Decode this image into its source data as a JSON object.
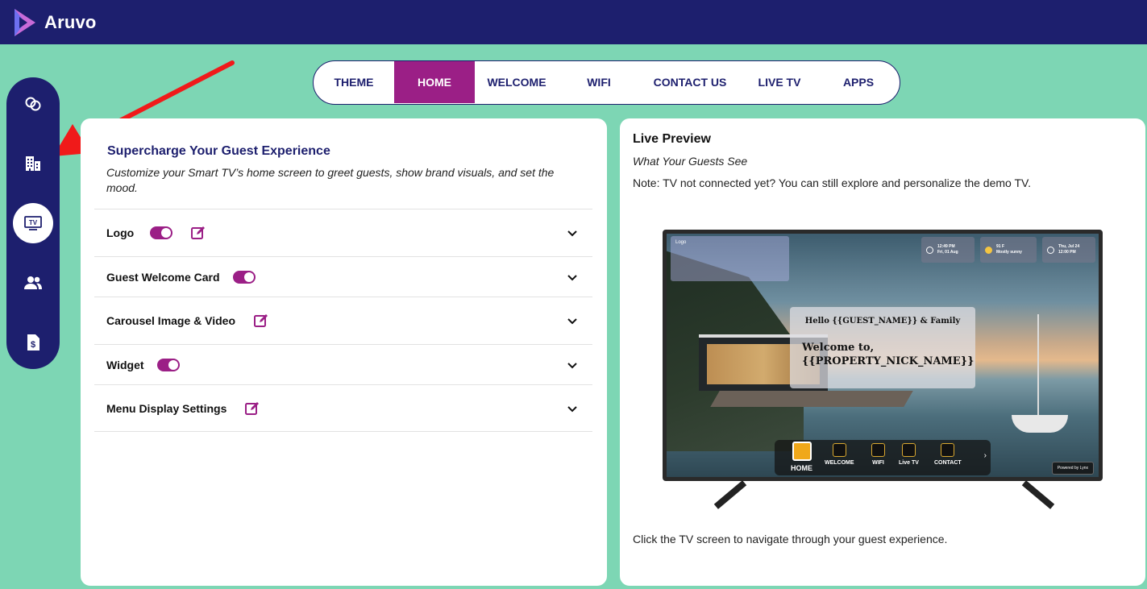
{
  "app": {
    "name": "Aruvo"
  },
  "sidebar": {
    "items": [
      {
        "icon": "linked-rings-icon"
      },
      {
        "icon": "building-icon"
      },
      {
        "icon": "tv-icon",
        "label": "TV",
        "active": true
      },
      {
        "icon": "users-icon"
      },
      {
        "icon": "invoice-icon"
      }
    ]
  },
  "tabs": [
    {
      "label": "THEME"
    },
    {
      "label": "HOME",
      "active": true
    },
    {
      "label": "WELCOME"
    },
    {
      "label": "WIFI"
    },
    {
      "label": "CONTACT US"
    },
    {
      "label": "LIVE TV"
    },
    {
      "label": "APPS"
    }
  ],
  "settings": {
    "title": "Supercharge Your Guest Experience",
    "description": "Customize your Smart TV’s home screen to greet guests, show brand visuals, and set the mood.",
    "sections": [
      {
        "label": "Logo",
        "toggle": true,
        "edit": true
      },
      {
        "label": "Guest Welcome Card",
        "toggle": true,
        "edit": false
      },
      {
        "label": "Carousel Image & Video",
        "toggle": false,
        "edit": true
      },
      {
        "label": "Widget",
        "toggle": true,
        "edit": false
      },
      {
        "label": "Menu Display Settings",
        "toggle": false,
        "edit": true
      }
    ]
  },
  "preview": {
    "title": "Live Preview",
    "subtitle": "What Your Guests See",
    "note": "Note: TV not connected yet? You can still explore and personalize the demo TV.",
    "footer": "Click the TV screen to navigate through your guest experience.",
    "tv": {
      "logo_alt": "Logo",
      "widgets": {
        "time": "12:49 PM",
        "date": "Fri, 01 Aug",
        "temp": "91 F",
        "weather": "Mostly sunny",
        "checkout_date": "Thu, Jul 24",
        "checkout_time": "12:00 PM"
      },
      "hello": "Hello {{GUEST_NAME}} & Family",
      "welcome_line1": "Welcome to,",
      "welcome_line2": "{{PROPERTY_NICK_NAME}}",
      "menu": [
        "HOME",
        "WELCOME",
        "WIFI",
        "Live TV",
        "CONTACT"
      ],
      "menu_more": "›",
      "powered_by": "Powered by Lynx"
    }
  },
  "colors": {
    "navy": "#1d1f6e",
    "magenta": "#9b1f86",
    "mint": "#7dd6b4"
  }
}
